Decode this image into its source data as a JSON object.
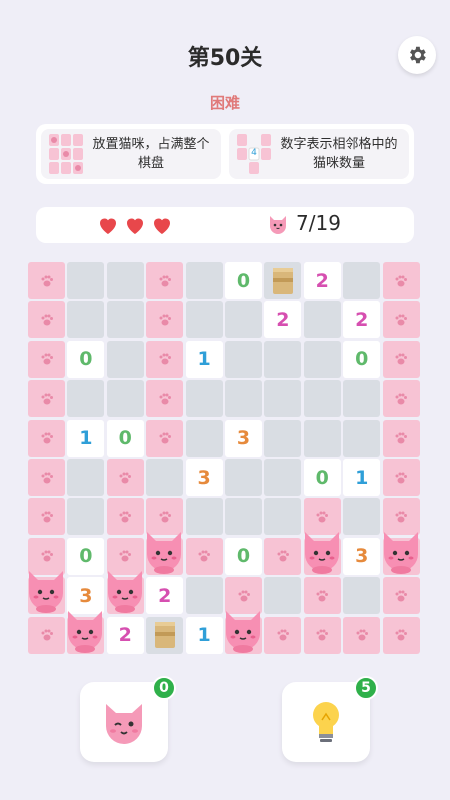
{
  "header": {
    "title": "第50关",
    "difficulty": "困难"
  },
  "rules": [
    {
      "text": "放置猫咪，占满整个棋盘",
      "thumb_number": ""
    },
    {
      "text": "数字表示相邻格中的猫咪数量",
      "thumb_number": "4"
    }
  ],
  "status": {
    "lives": 3,
    "cat_progress": "7/19"
  },
  "colors": {
    "number": [
      "#5fb96b",
      "#2f9fd8",
      "#d64fb0",
      "#e68a3c"
    ]
  },
  "board": {
    "rows": 10,
    "cols": 10,
    "grid": [
      [
        "P",
        "E",
        "E",
        "P",
        "E",
        "0",
        "B",
        "2",
        "E",
        "P"
      ],
      [
        "P",
        "E",
        "E",
        "P",
        "E",
        "E",
        "2",
        "E",
        "2",
        "P"
      ],
      [
        "P",
        "0",
        "E",
        "P",
        "1",
        "E",
        "E",
        "E",
        "0",
        "P"
      ],
      [
        "P",
        "E",
        "E",
        "P",
        "E",
        "E",
        "E",
        "E",
        "E",
        "P"
      ],
      [
        "P",
        "1",
        "0",
        "P",
        "E",
        "3",
        "E",
        "E",
        "E",
        "P"
      ],
      [
        "P",
        "E",
        "P",
        "E",
        "3",
        "E",
        "E",
        "0",
        "1",
        "P"
      ],
      [
        "P",
        "E",
        "P",
        "P",
        "E",
        "E",
        "E",
        "P",
        "E",
        "P"
      ],
      [
        "P",
        "0",
        "P",
        "C",
        "P",
        "0",
        "P",
        "C",
        "3",
        "C"
      ],
      [
        "C",
        "3",
        "C",
        "2",
        "E",
        "P",
        "E",
        "P",
        "E",
        "P"
      ],
      [
        "P",
        "C",
        "2",
        "B",
        "1",
        "C",
        "P",
        "P",
        "P",
        "P"
      ]
    ]
  },
  "buttons": {
    "cat_hint": {
      "icon": "winking-cat-icon",
      "count": "0"
    },
    "bulb_hint": {
      "icon": "lightbulb-icon",
      "count": "5"
    }
  }
}
